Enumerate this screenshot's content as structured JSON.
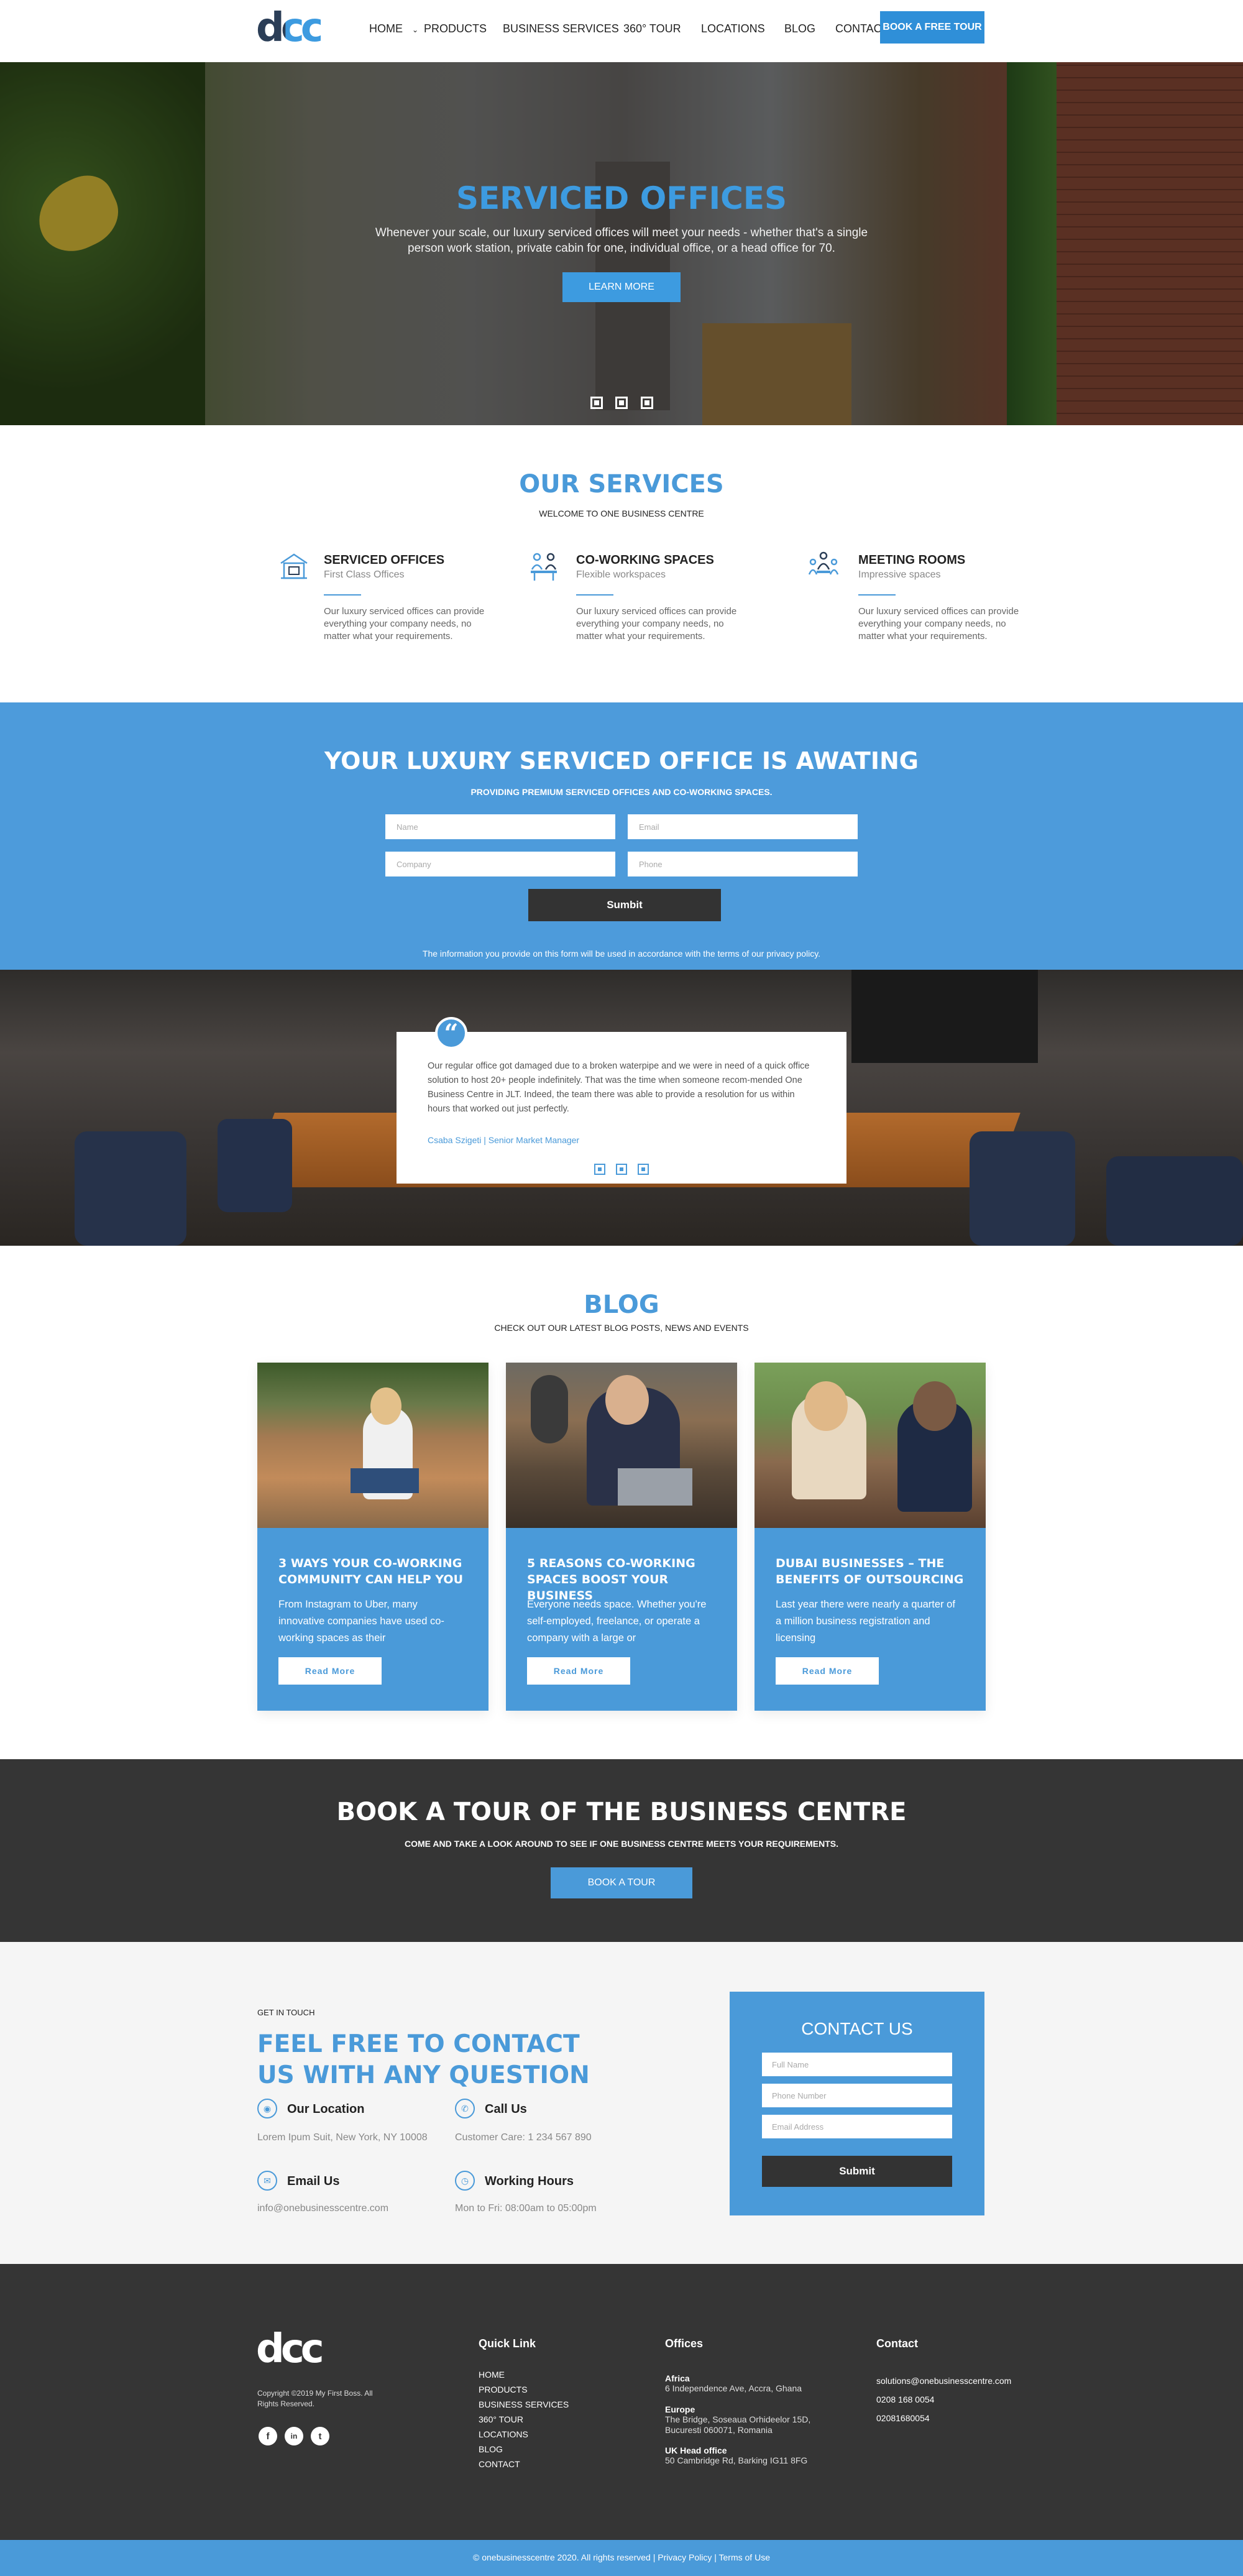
{
  "nav": {
    "logo": "dcc",
    "items": [
      "HOME",
      "PRODUCTS",
      "BUSINESS SERVICES",
      "360° TOUR",
      "LOCATIONS",
      "BLOG",
      "CONTACT"
    ],
    "cta": "BOOK A FREE TOUR"
  },
  "hero": {
    "title": "SERVICED OFFICES",
    "text": "Whenever your scale, our luxury serviced offices will meet your needs - whether that's a single person work station, private cabin for one, individual office, or a head office for 70.",
    "button": "LEARN MORE"
  },
  "services": {
    "title": "OUR SERVICES",
    "subtitle": "WELCOME TO ONE BUSINESS CENTRE",
    "items": [
      {
        "title": "SERVICED OFFICES",
        "subtitle": "First Class Offices",
        "desc": "Our luxury serviced offices can provide everything your company needs, no matter what your requirements.",
        "icon": "office-icon"
      },
      {
        "title": "CO-WORKING SPACES",
        "subtitle": "Flexible workspaces",
        "desc": "Our luxury serviced offices can provide everything your company needs, no matter what your requirements.",
        "icon": "coworking-icon"
      },
      {
        "title": "MEETING ROOMS",
        "subtitle": "Impressive spaces",
        "desc": "Our luxury serviced offices can provide everything your company needs, no matter what your requirements.",
        "icon": "meeting-icon"
      }
    ]
  },
  "quote_form": {
    "title": "YOUR LUXURY SERVICED OFFICE IS AWATING",
    "subtitle": "PROVIDING PREMIUM SERVICED OFFICES AND CO-WORKING SPACES.",
    "placeholders": [
      "Name",
      "Email",
      "Company",
      "Phone"
    ],
    "submit": "Sumbit",
    "note": "The information you provide on this form will be used in accordance with the terms of our privacy policy."
  },
  "testimonial": {
    "text": "Our regular office got damaged due to a broken waterpipe and we were in need of a quick office solution to host 20+ people indefinitely. That was the time when someone recom-mended One Business Centre in JLT. Indeed, the team there was able to provide a resolution for us within hours that worked out just perfectly.",
    "author": "Csaba Szigeti | Senior Market Manager"
  },
  "blog": {
    "title": "BLOG",
    "subtitle": "CHECK OUT OUR LATEST BLOG POSTS, NEWS AND EVENTS",
    "posts": [
      {
        "title": "3 WAYS YOUR CO-WORKING COMMUNITY CAN HELP YOU",
        "text": "From Instagram to Uber, many innovative companies have used co-working spaces as their",
        "button": "Read More"
      },
      {
        "title": "5 REASONS CO-WORKING SPACES BOOST YOUR BUSINESS",
        "text": "Everyone needs space. Whether you're self-employed, freelance, or operate a company with a large or",
        "button": "Read More"
      },
      {
        "title": "DUBAI BUSINESSES – THE BENEFITS OF OUTSOURCING",
        "text": "Last year there were nearly a quarter of a million business registration and licensing",
        "button": "Read More"
      }
    ]
  },
  "tour": {
    "title": "BOOK A TOUR OF THE BUSINESS CENTRE",
    "subtitle": "COME AND TAKE A LOOK AROUND TO SEE IF ONE BUSINESS CENTRE MEETS YOUR REQUIREMENTS.",
    "button": "BOOK A TOUR"
  },
  "contact": {
    "eyebrow": "GET IN TOUCH",
    "title": "FEEL FREE TO CONTACT US WITH ANY QUESTION",
    "info": [
      {
        "title": "Our Location",
        "text": "Lorem Ipum Suit, New York, NY 10008"
      },
      {
        "title": "Call Us",
        "text": "Customer Care: 1 234 567 890"
      },
      {
        "title": "Email Us",
        "text": "info@onebusinesscentre.com"
      },
      {
        "title": "Working Hours",
        "text": "Mon to Fri: 08:00am to 05:00pm"
      }
    ],
    "box": {
      "title": "CONTACT US",
      "placeholders": [
        "Full Name",
        "Phone Number",
        "Email Address"
      ],
      "submit": "Submit"
    }
  },
  "footer": {
    "logo": "dcc",
    "copyright": "Copyright ©2019 My First Boss. All Rights Reserved.",
    "quick_link_title": "Quick Link",
    "quick_links": [
      "HOME",
      "PRODUCTS",
      "BUSINESS SERVICES",
      "360° TOUR",
      "LOCATIONS",
      "BLOG",
      "CONTACT"
    ],
    "offices_title": "Offices",
    "offices": [
      {
        "region": "Africa",
        "address": "6 Independence Ave, Accra, Ghana"
      },
      {
        "region": "Europe",
        "address": "The Bridge, Soseaua Orhideelor 15D, Bucuresti 060071, Romania"
      },
      {
        "region": "UK Head office",
        "address": "50 Cambridge Rd, Barking IG11 8FG"
      }
    ],
    "contact_title": "Contact",
    "contact_lines": [
      "solutions@onebusinesscentre.com",
      "0208 168 0054",
      "02081680054"
    ],
    "social": [
      "f",
      "in",
      "t"
    ],
    "bottom": "© onebusinesscentre 2020. All rights reserved | Privacy Policy | Terms of Use"
  },
  "colors": {
    "accent": "#4a9ad9",
    "dark": "#353535",
    "cta": "#2f8fd8"
  }
}
